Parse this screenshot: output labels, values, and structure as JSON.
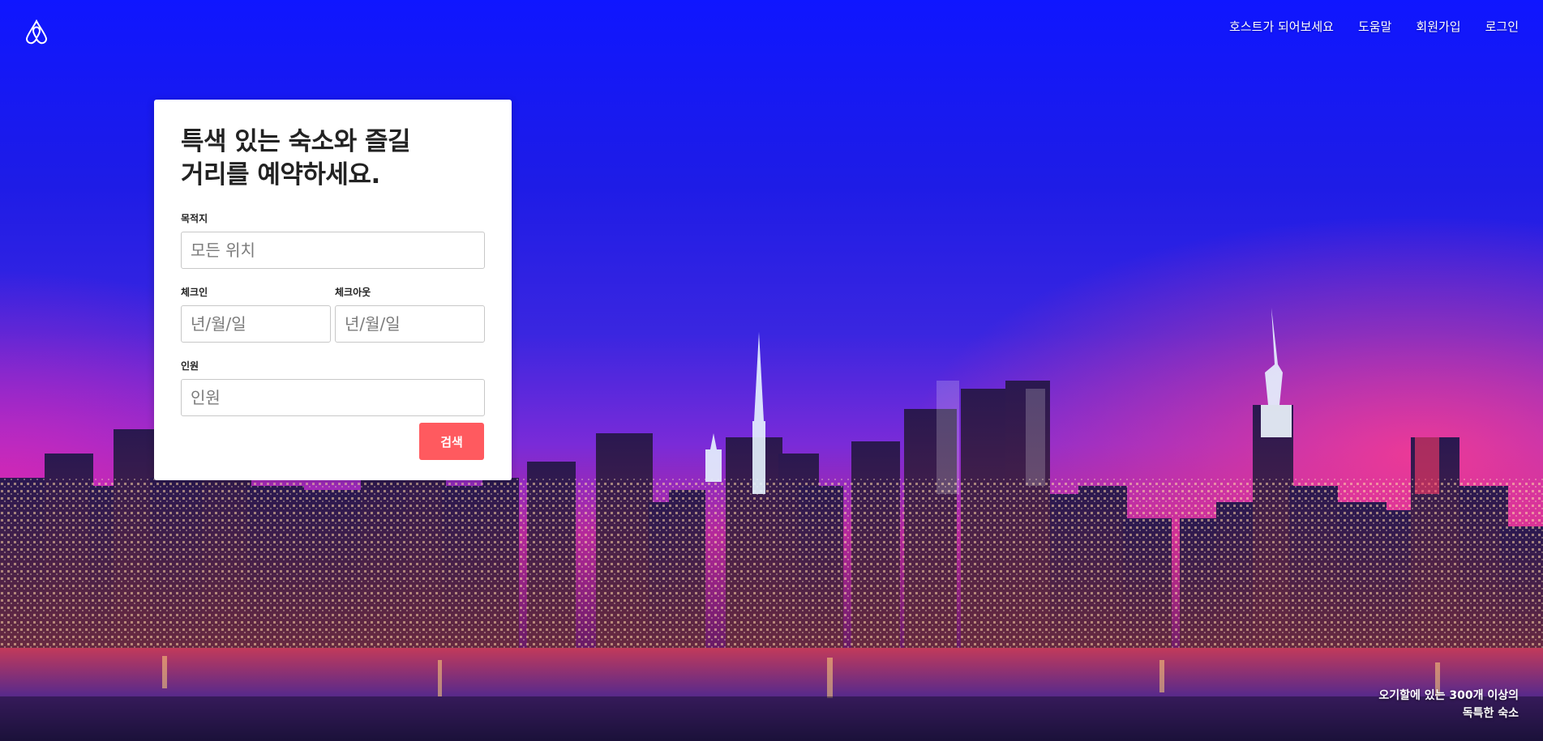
{
  "nav": {
    "logo_icon": "airbnb-logo-icon",
    "links": [
      "호스트가 되어보세요",
      "도움말",
      "회원가입",
      "로그인"
    ]
  },
  "search": {
    "title": "특색 있는 숙소와 즐길 거리를 예약하세요.",
    "destination_label": "목적지",
    "destination_placeholder": "모든 위치",
    "checkin_label": "체크인",
    "checkin_placeholder": "년/월/일",
    "checkout_label": "체크아웃",
    "checkout_placeholder": "년/월/일",
    "guests_label": "인원",
    "guests_placeholder": "인원",
    "submit_label": "검색"
  },
  "promo": {
    "line1": "오기할에 있는 300개 이상의",
    "line2": "독특한 숙소"
  },
  "colors": {
    "accent": "#ff5a5f",
    "sky_top": "#0f16ff",
    "sky_glow": "#ff3c8c"
  }
}
